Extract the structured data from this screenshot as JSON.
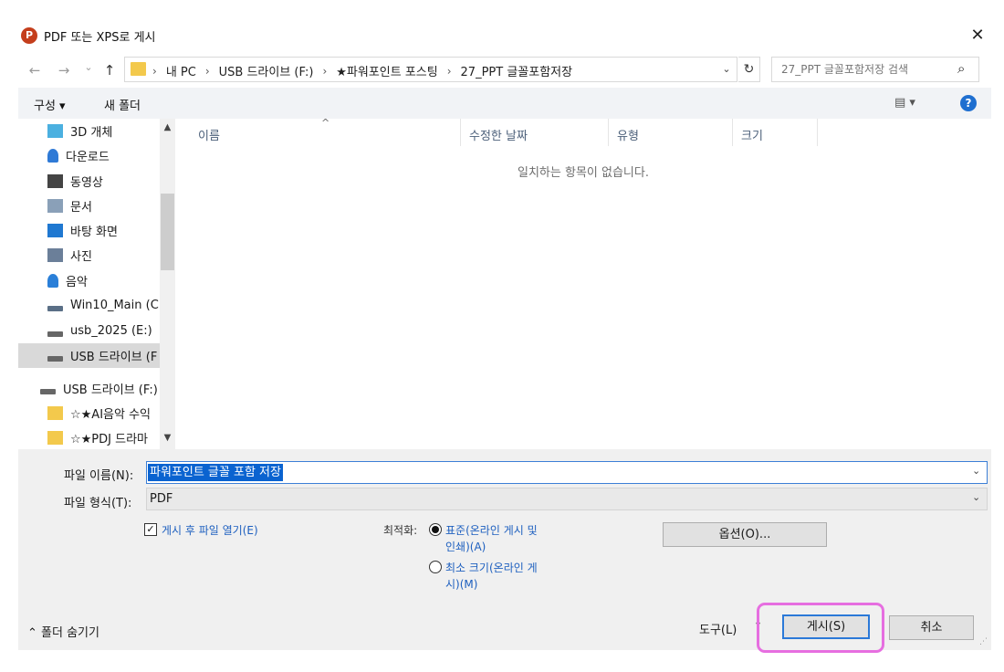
{
  "window": {
    "title": "PDF 또는 XPS로 게시",
    "app_icon_letter": "P",
    "close_glyph": "✕"
  },
  "nav": {
    "back_glyph": "←",
    "forward_glyph": "→",
    "recent_glyph": "⌄",
    "up_glyph": "↑",
    "breadcrumbs": [
      "내 PC",
      "USB 드라이브 (F:)",
      "★파워포인트 포스팅",
      "27_PPT 글꼴포함저장"
    ],
    "breadcrumb_separator": "›",
    "refresh_glyph": "↻",
    "search_placeholder": "27_PPT 글꼴포함저장 검색",
    "search_glyph": "⌕"
  },
  "toolbar": {
    "organize_label": "구성 ▾",
    "new_folder_label": "새 폴더",
    "view_label": "▤ ▾",
    "help_glyph": "?"
  },
  "sidebar": {
    "items": [
      {
        "label": "3D 개체",
        "icon": "3d-objects-icon",
        "color": "#4bb0e0"
      },
      {
        "label": "다운로드",
        "icon": "download-icon",
        "color": "#2f7ad6"
      },
      {
        "label": "동영상",
        "icon": "video-icon",
        "color": "#444444"
      },
      {
        "label": "문서",
        "icon": "document-icon",
        "color": "#8aa0b8"
      },
      {
        "label": "바탕 화면",
        "icon": "desktop-icon",
        "color": "#1f78d1"
      },
      {
        "label": "사진",
        "icon": "pictures-icon",
        "color": "#6b7f99"
      },
      {
        "label": "음악",
        "icon": "music-icon",
        "color": "#2a7fd8"
      },
      {
        "label": "Win10_Main (C:",
        "icon": "drive-c-icon",
        "color": "#5a6f86"
      },
      {
        "label": "usb_2025 (E:)",
        "icon": "usb-drive-icon",
        "color": "#666666"
      },
      {
        "label": "USB 드라이브 (F",
        "icon": "usb-drive-icon",
        "color": "#666666"
      },
      {
        "label": "USB 드라이브 (F:)",
        "icon": "usb-drive-icon",
        "color": "#666666"
      },
      {
        "label": "☆★AI음악 수익",
        "icon": "folder-icon",
        "color": "#f3c94c"
      },
      {
        "label": "☆★PDJ 드라마",
        "icon": "folder-icon",
        "color": "#f3c94c"
      }
    ],
    "selected_index": 9
  },
  "filelist": {
    "columns": [
      "이름",
      "수정한 날짜",
      "유형",
      "크기"
    ],
    "sort_glyph": "^",
    "empty_message": "일치하는 항목이 없습니다."
  },
  "form": {
    "filename_label": "파일 이름(N):",
    "filename_value": "파워포인트 글꼴 포함 저장",
    "filetype_label": "파일 형식(T):",
    "filetype_value": "PDF",
    "dropdown_glyph": "⌄",
    "open_after_label": "게시 후 파일 열기(E)",
    "open_after_checked": true,
    "optimize_label": "최적화:",
    "radio_standard_line1": "표준(온라인 게시 및",
    "radio_standard_line2": "인쇄)(A)",
    "radio_minimum_line1": "최소 크기(온라인 게",
    "radio_minimum_line2": "시)(M)",
    "options_button": "옵션(O)..."
  },
  "footer": {
    "hide_folders_label": "⌃ 폴더 숨기기",
    "tools_label": "도구(L)",
    "tools_dd_glyph": "▾",
    "publish_button": "게시(S)",
    "cancel_button": "취소",
    "highlight_color": "#e66ee0"
  }
}
